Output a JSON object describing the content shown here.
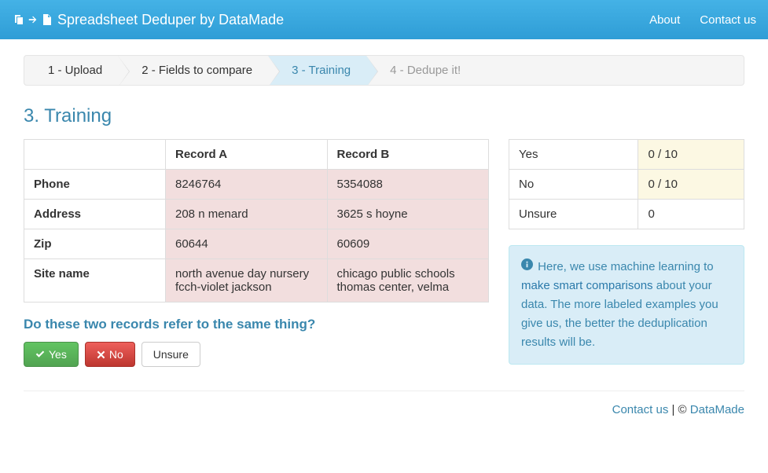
{
  "navbar": {
    "brand": "Spreadsheet Deduper by DataMade",
    "links": {
      "about": "About",
      "contact": "Contact us"
    }
  },
  "wizard": {
    "steps": [
      "1 - Upload",
      "2 - Fields to compare",
      "3 - Training",
      "4 - Dedupe it!"
    ],
    "active_index": 2,
    "disabled_index": 3
  },
  "page_title": "3. Training",
  "records": {
    "header_a": "Record A",
    "header_b": "Record B",
    "rows": [
      {
        "field": "Phone",
        "a": "8246764",
        "b": "5354088"
      },
      {
        "field": "Address",
        "a": "208 n menard",
        "b": "3625 s hoyne"
      },
      {
        "field": "Zip",
        "a": "60644",
        "b": "60609"
      },
      {
        "field": "Site name",
        "a": "north avenue day nursery fcch-violet jackson",
        "b": "chicago public schools thomas center, velma"
      }
    ]
  },
  "question": "Do these two records refer to the same thing?",
  "buttons": {
    "yes": "Yes",
    "no": "No",
    "unsure": "Unsure"
  },
  "counts": {
    "yes_label": "Yes",
    "yes_value": "0 / 10",
    "no_label": "No",
    "no_value": "0 / 10",
    "unsure_label": "Unsure",
    "unsure_value": "0"
  },
  "info": {
    "pre": "Here, we use machine learning to ",
    "link": "make smart comparisons",
    "post": " about your data. The more labeled examples you give us, the better the deduplication results will be."
  },
  "footer": {
    "contact": "Contact us",
    "sep": " | © ",
    "datamade": "DataMade"
  }
}
